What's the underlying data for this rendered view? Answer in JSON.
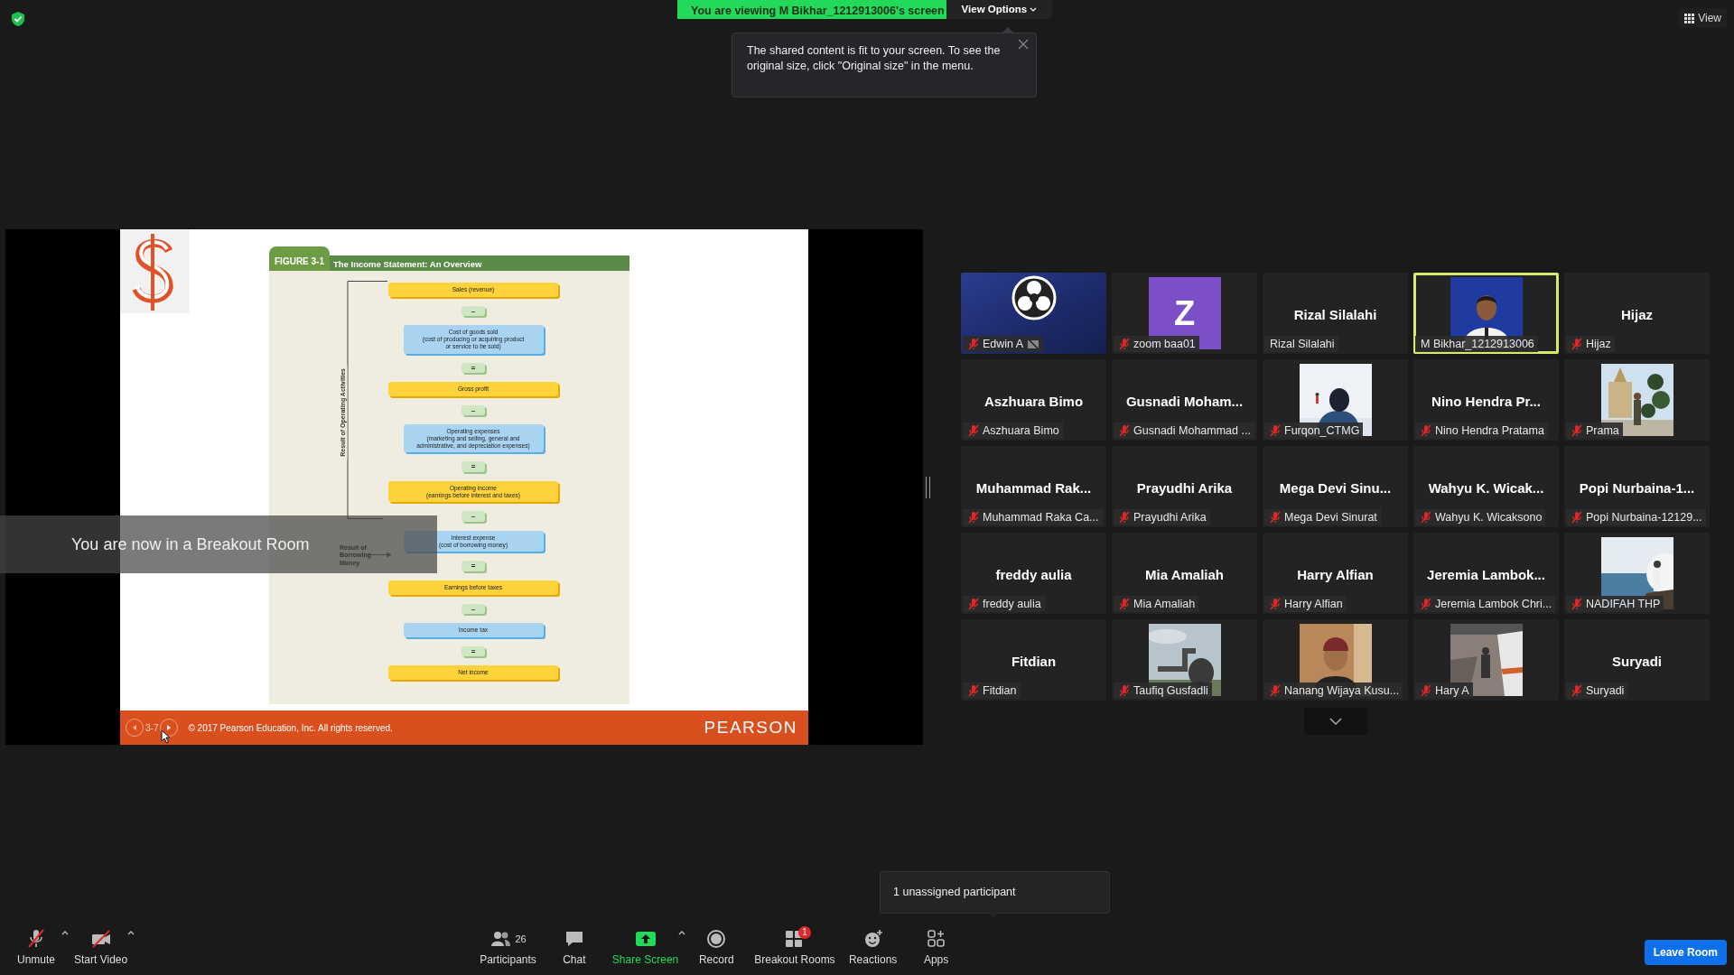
{
  "share_banner": {
    "text": "You are viewing M Bikhar_1212913006's screen",
    "view_options": "View Options"
  },
  "fit_tooltip": "The shared content is fit to your screen. To see the original size, click \"Original size\" in the menu.",
  "view_button": "View",
  "slide": {
    "figure_tag": "FIGURE 3-1",
    "figure_title": "The Income Statement: An Overview",
    "bracket_label": "Result of Operating Activities",
    "borrowing_label": "Result of Borrowing Money",
    "steps": [
      {
        "kind": "total",
        "lines": [
          "Sales (revenue)"
        ]
      },
      {
        "kind": "operator",
        "lines": [
          "–"
        ]
      },
      {
        "kind": "item",
        "lines": [
          "Cost of goods sold",
          "(cost of producing or acquiring product",
          "or service to be sold)"
        ]
      },
      {
        "kind": "operator",
        "lines": [
          "="
        ]
      },
      {
        "kind": "total",
        "lines": [
          "Gross profit"
        ]
      },
      {
        "kind": "operator",
        "lines": [
          "–"
        ]
      },
      {
        "kind": "item",
        "lines": [
          "Operating expenses",
          "(marketing and selling, general and",
          "administrative, and depreciation expenses)"
        ]
      },
      {
        "kind": "operator",
        "lines": [
          "="
        ]
      },
      {
        "kind": "total",
        "lines": [
          "Operating income",
          "(earnings before interest and taxes)"
        ]
      },
      {
        "kind": "operator",
        "lines": [
          "–"
        ]
      },
      {
        "kind": "item",
        "lines": [
          "Interest expense",
          "(cost of borrowing money)"
        ]
      },
      {
        "kind": "operator",
        "lines": [
          "="
        ]
      },
      {
        "kind": "total",
        "lines": [
          "Earnings before taxes"
        ]
      },
      {
        "kind": "operator",
        "lines": [
          "–"
        ]
      },
      {
        "kind": "item",
        "lines": [
          "Income tax"
        ]
      },
      {
        "kind": "operator",
        "lines": [
          "="
        ]
      },
      {
        "kind": "total",
        "lines": [
          "Net income"
        ]
      }
    ],
    "slide_number": "3-7",
    "copyright": "© 2017 Pearson Education, Inc. All rights reserved.",
    "brand": "PEARSON"
  },
  "breakout_notice": "You are now in a Breakout Room",
  "tiles": [
    {
      "kind": "logo",
      "label": "Edwin A",
      "muted": true,
      "camera_off": true,
      "speaking": false
    },
    {
      "kind": "avatar",
      "initial": "Z",
      "label": "zoom baa01",
      "muted": true,
      "camera_off": false,
      "speaking": false
    },
    {
      "kind": "name",
      "display_name": "Rizal Silalahi",
      "label": "Rizal Silalahi",
      "muted": false,
      "camera_off": false,
      "speaking": false
    },
    {
      "kind": "picture",
      "label": "M Bikhar_1212913006",
      "muted": false,
      "camera_off": false,
      "speaking": true
    },
    {
      "kind": "name",
      "display_name": "Hijaz",
      "label": "Hijaz",
      "muted": true,
      "camera_off": false,
      "speaking": false
    },
    {
      "kind": "name",
      "display_name": "Aszhuara Bimo",
      "label": "Aszhuara Bimo",
      "muted": true,
      "camera_off": false,
      "speaking": false
    },
    {
      "kind": "name",
      "display_name": "Gusnadi Moham...",
      "label": "Gusnadi Mohammad ...",
      "muted": true,
      "camera_off": false,
      "speaking": false
    },
    {
      "kind": "picture",
      "label": "Furqon_CTMG",
      "muted": true,
      "camera_off": false,
      "speaking": false
    },
    {
      "kind": "name",
      "display_name": "Nino Hendra Pr...",
      "label": "Nino Hendra Pratama",
      "muted": true,
      "camera_off": false,
      "speaking": false
    },
    {
      "kind": "picture",
      "label": "Prama",
      "muted": true,
      "camera_off": false,
      "speaking": false
    },
    {
      "kind": "name",
      "display_name": "Muhammad Rak...",
      "label": "Muhammad Raka Ca...",
      "muted": true,
      "camera_off": false,
      "speaking": false
    },
    {
      "kind": "name",
      "display_name": "Prayudhi Arika",
      "label": "Prayudhi Arika",
      "muted": true,
      "camera_off": false,
      "speaking": false
    },
    {
      "kind": "name",
      "display_name": "Mega Devi Sinu...",
      "label": "Mega Devi Sinurat",
      "muted": true,
      "camera_off": false,
      "speaking": false
    },
    {
      "kind": "name",
      "display_name": "Wahyu K. Wicak...",
      "label": "Wahyu K. Wicaksono",
      "muted": true,
      "camera_off": false,
      "speaking": false
    },
    {
      "kind": "name",
      "display_name": "Popi Nurbaina-1...",
      "label": "Popi Nurbaina-12129...",
      "muted": true,
      "camera_off": false,
      "speaking": false
    },
    {
      "kind": "name",
      "display_name": "freddy aulia",
      "label": "freddy aulia",
      "muted": true,
      "camera_off": false,
      "speaking": false
    },
    {
      "kind": "name",
      "display_name": "Mia Amaliah",
      "label": "Mia Amaliah",
      "muted": true,
      "camera_off": false,
      "speaking": false
    },
    {
      "kind": "name",
      "display_name": "Harry Alfian",
      "label": "Harry Alfian",
      "muted": true,
      "camera_off": false,
      "speaking": false
    },
    {
      "kind": "name",
      "display_name": "Jeremia Lambok...",
      "label": "Jeremia Lambok Chri...",
      "muted": true,
      "camera_off": false,
      "speaking": false
    },
    {
      "kind": "picture",
      "label": "NADIFAH THP",
      "muted": true,
      "camera_off": false,
      "speaking": false
    },
    {
      "kind": "name",
      "display_name": "Fitdian",
      "label": "Fitdian",
      "muted": true,
      "camera_off": false,
      "speaking": false
    },
    {
      "kind": "picture",
      "label": "Taufiq Gusfadli",
      "muted": true,
      "camera_off": false,
      "speaking": false
    },
    {
      "kind": "picture",
      "label": "Nanang Wijaya Kusu...",
      "muted": true,
      "camera_off": false,
      "speaking": false
    },
    {
      "kind": "picture",
      "label": "Hary A",
      "muted": true,
      "camera_off": false,
      "speaking": false
    },
    {
      "kind": "name",
      "display_name": "Suryadi",
      "label": "Suryadi",
      "muted": true,
      "camera_off": false,
      "speaking": false
    }
  ],
  "unassigned_tooltip": "1 unassigned participant",
  "left_controls": [
    {
      "kind": "mic",
      "label": "Unmute",
      "caret": true
    },
    {
      "kind": "video",
      "label": "Start Video",
      "caret": true
    }
  ],
  "center_controls": [
    {
      "kind": "participants",
      "label": "Participants",
      "count": "26",
      "caret": false
    },
    {
      "kind": "chat",
      "label": "Chat",
      "caret": false
    },
    {
      "kind": "share",
      "label": "Share Screen",
      "caret": true
    },
    {
      "kind": "record",
      "label": "Record",
      "caret": false
    },
    {
      "kind": "breakout",
      "label": "Breakout Rooms",
      "badge": "1",
      "caret": false
    },
    {
      "kind": "reactions",
      "label": "Reactions",
      "caret": false
    },
    {
      "kind": "apps",
      "label": "Apps",
      "caret": false
    }
  ],
  "leave_button": "Leave Room"
}
